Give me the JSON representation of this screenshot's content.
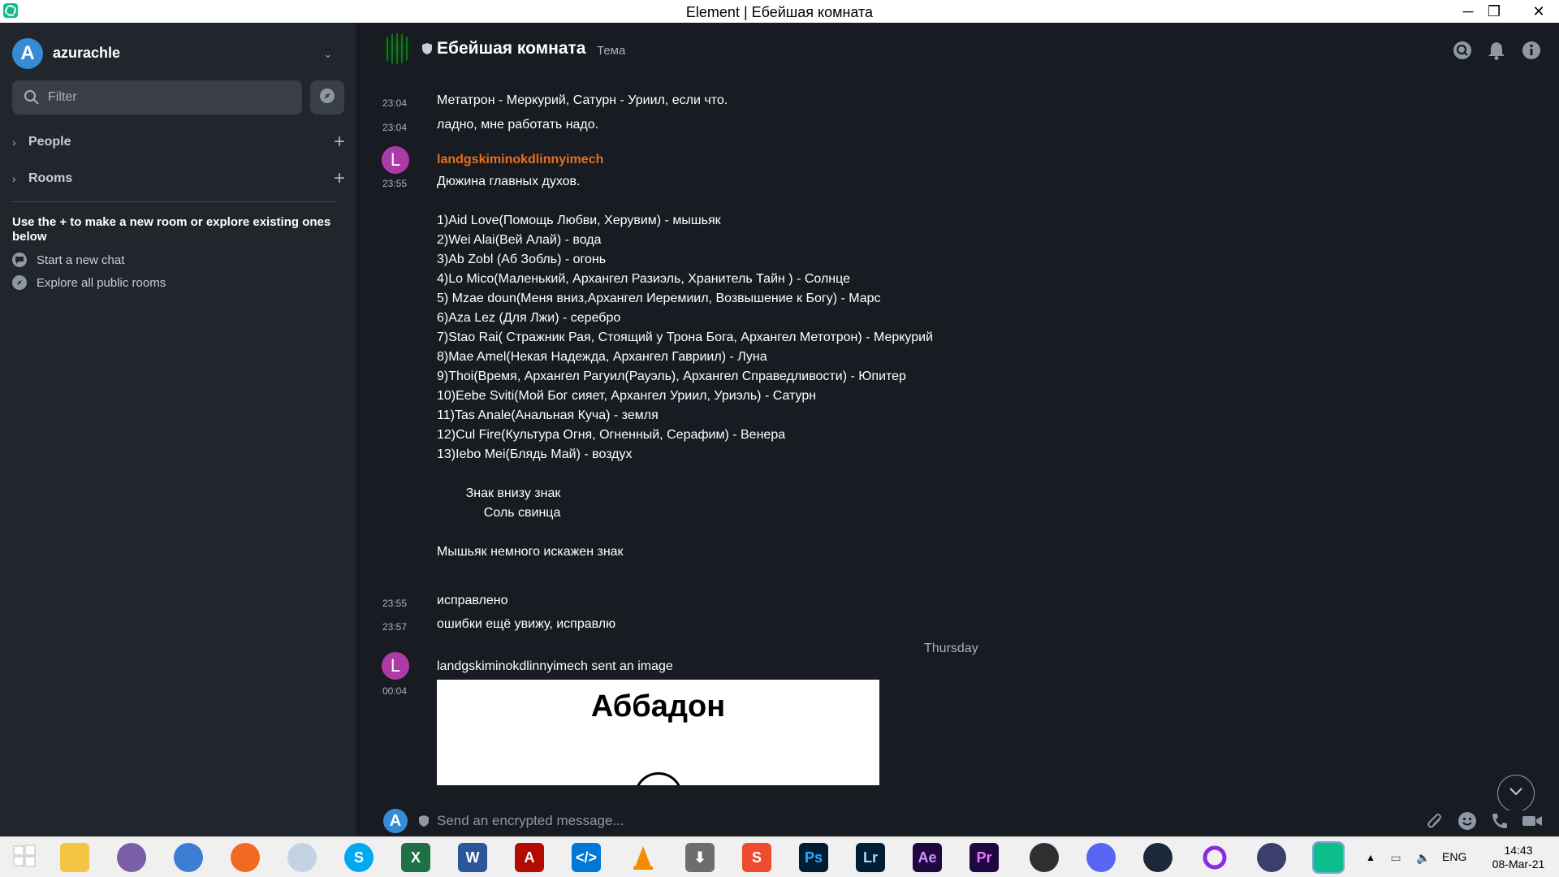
{
  "window": {
    "title": "Element | Ебейшая комната",
    "minimize": "─",
    "restore": "❐",
    "close": "✕"
  },
  "user": {
    "avatar_letter": "A",
    "name": "azurachle"
  },
  "filter": {
    "placeholder": "Filter"
  },
  "sections": [
    {
      "label": "People"
    },
    {
      "label": "Rooms"
    }
  ],
  "hint": {
    "text": "Use the + to make a new room or explore existing ones below",
    "start_chat": "Start a new chat",
    "explore_rooms": "Explore all public rooms"
  },
  "room": {
    "name": "Ебейшая комната",
    "topic": "Тема"
  },
  "messages": [
    {
      "time": "23:04",
      "text": "Метатрон - Меркурий, Сатурн - Уриил, если что."
    },
    {
      "time": "23:04",
      "text": "ладно, мне работать надо."
    }
  ],
  "long_post": {
    "sender": "landgskiminokdlinnyimech",
    "avatar_letter": "L",
    "time": "23:55",
    "lines": [
      "Дюжина главных духов.",
      "",
      "1)Aid Love(Помощь Любви, Херувим) - мышьяк",
      "2)Wei Alai(Вей Алай) - вода",
      "3)Ab Zobl (Аб Зобль) - огонь",
      "4)Lo Mico(Маленький, Архангел Разиэль, Хранитель Тайн ) - Солнце",
      "5) Mzae doun(Меня вниз,Архангел Иеремиил, Возвышение к Богу) - Марс",
      "6)Aza Lez (Для Лжи) - серебро",
      "7)Stao Rai( Стражник Рая, Стоящий у Трона Бога, Архангел Метотрон) - Меркурий",
      "8)Mae Amel(Некая Надежда, Архангел Гавриил) - Луна",
      "9)Thoi(Время, Архангел Рагуил(Рауэль), Архангел Справедливости) - Юпитер",
      "10)Eebe Sviti(Мой Бог сияет, Архангел Уриил, Уриэль) - Сатурн",
      "11)Tas Anale(Анальная Куча) - земля",
      "12)Cul Fire(Культура Огня, Огненный, Серафим) - Венера",
      "13)Iebo Mei(Блядь Май) - воздух",
      "",
      "        Знак внизу знак",
      "             Соль свинца",
      "",
      "Мышьяк немного искажен знак"
    ]
  },
  "followups": [
    {
      "time": "23:55",
      "text": "исправлено"
    },
    {
      "time": "23:57",
      "text": "ошибки ещё увижу, исправлю"
    }
  ],
  "date_separator": "Thursday",
  "image_post": {
    "avatar_letter": "L",
    "time": "00:04",
    "text": "landgskiminokdlinnyimech sent an image",
    "image_title": "Аббадон"
  },
  "composer": {
    "avatar_letter": "A",
    "placeholder": "Send an encrypted message..."
  },
  "taskbar": {
    "lang": "ENG",
    "time": "14:43",
    "date": "08-Mar-21"
  },
  "colors": {
    "accent": "#0dbd8b",
    "sender_name": "#e76f1e",
    "sender_avatar": "#ac3ba8",
    "user_avatar": "#368bd6"
  }
}
